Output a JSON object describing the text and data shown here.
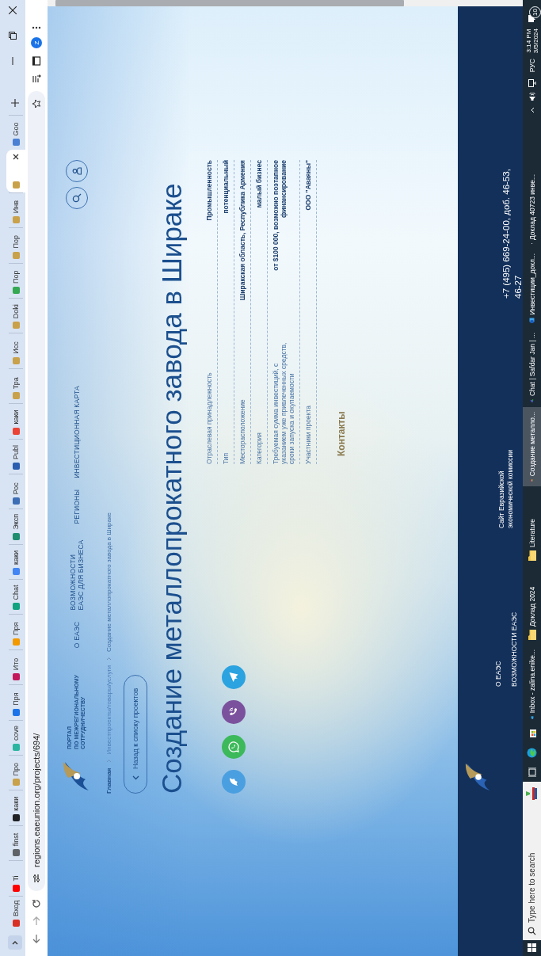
{
  "browser": {
    "tabs": [
      {
        "label": "Вход",
        "color": "#d93025",
        "selected": false
      },
      {
        "label": "Ti",
        "color": "#ff0000",
        "selected": false
      },
      {
        "label": "finst",
        "color": "#5f6368",
        "selected": false
      },
      {
        "label": "каки",
        "color": "#202124",
        "selected": false
      },
      {
        "label": "Про",
        "color": "#c9a14a",
        "selected": false
      },
      {
        "label": "cove",
        "color": "#2bb5a0",
        "selected": false
      },
      {
        "label": "Пря",
        "color": "#1a73e8",
        "selected": false
      },
      {
        "label": "Ито",
        "color": "#c2185b",
        "selected": false
      },
      {
        "label": "Пря",
        "color": "#f29900",
        "selected": false
      },
      {
        "label": "Chat",
        "color": "#10a37f",
        "selected": false
      },
      {
        "label": "каки",
        "color": "#4285f4",
        "selected": false
      },
      {
        "label": "Эксп",
        "color": "#1e8e6e",
        "selected": false
      },
      {
        "label": "Рос",
        "color": "#3c6db5",
        "selected": false
      },
      {
        "label": "Publ",
        "color": "#2a5db0",
        "selected": false
      },
      {
        "label": "каки",
        "color": "#ea4335",
        "selected": false
      },
      {
        "label": "Тра",
        "color": "#c9a14a",
        "selected": false
      },
      {
        "label": "Исс",
        "color": "#c9a14a",
        "selected": false
      },
      {
        "label": "Doki",
        "color": "#c9a14a",
        "selected": false
      },
      {
        "label": "Пор",
        "color": "#34a853",
        "selected": false
      },
      {
        "label": "Пор",
        "color": "#c9a14a",
        "selected": false
      },
      {
        "label": "Инв",
        "color": "#c9a14a",
        "selected": false
      },
      {
        "color": "#c9a14a",
        "selected": true
      },
      {
        "label": "Goo",
        "color": "#4a7fd4",
        "selected": false
      }
    ],
    "url": "regions.eaeunion.org/projects/694/",
    "profile": "Z"
  },
  "header": {
    "portal_lines": [
      "ПОРТАЛ",
      "ПО МЕЖРЕГИОНАЛЬНОМУ",
      "СОТРУДНИЧЕСТВУ"
    ],
    "nav": [
      "О ЕАЭС",
      "ВОЗМОЖНОСТИ ЕАЭС ДЛЯ БИЗНЕСА",
      "РЕГИОНЫ",
      "ИНВЕСТИЦИОННАЯ КАРТА"
    ]
  },
  "breadcrumbs": [
    "Главная",
    "Инвестпроекты/товары/услуги",
    "Создание металлопрокатного завода в Шираке"
  ],
  "back_button": "Назад к списку проектов",
  "title": "Создание металлопрокатного завода в Шираке",
  "share": [
    {
      "kind": "bird",
      "color": "#4a9fe0"
    },
    {
      "kind": "whatsapp",
      "color": "#3cb95a"
    },
    {
      "kind": "viber",
      "color": "#7b519d"
    },
    {
      "kind": "telegram",
      "color": "#2aa3e0"
    }
  ],
  "details": [
    {
      "label": "Отраслевая принадлежность",
      "value": "Промышленность"
    },
    {
      "label": "Тип",
      "value": "потенциальный"
    },
    {
      "label": "Месторасположение",
      "value": "Ширакская область, Республика Армения"
    },
    {
      "label": "Категория",
      "value": "малый бизнес"
    },
    {
      "label": "Требуемая сумма инвестиций, с указанием уже привлеченных средств, сроки запуска и окупаемости",
      "value": "от $100 000, возможно поэтапное финансирование"
    },
    {
      "label": "Участники проекта",
      "value": "ООО \"Аваяны\""
    }
  ],
  "contacts_heading": "Контакты",
  "footer": {
    "links": [
      "О ЕАЭС",
      "ВОЗМОЖНОСТИ ЕАЭС"
    ],
    "commission_link": "Сайт Евразийской экономической комиссии",
    "phone": "+7 (495) 669-24-00, доб. 46-53, 46-27"
  },
  "taskbar": {
    "search_placeholder": "Type here to search",
    "apps": [
      {
        "kind": "taskview",
        "selected": false
      },
      {
        "kind": "edge",
        "selected": false
      },
      {
        "kind": "store",
        "selected": false
      },
      {
        "kind": "outlook",
        "label": "Inbox - zalina.enike...",
        "selected": false
      },
      {
        "kind": "folder",
        "label": "Доклад 2024",
        "selected": false
      },
      {
        "kind": "folder",
        "label": "Literature",
        "selected": false
      },
      {
        "kind": "chrome",
        "label": "Создание металло...",
        "selected": true
      },
      {
        "kind": "teams",
        "label": "Chat | Safdar Jan | ...",
        "selected": false
      },
      {
        "kind": "word",
        "label": "Инвестиции_докл...",
        "selected": false
      },
      {
        "kind": "pdf",
        "label": "Доклад 40723 инве...",
        "selected": false
      }
    ],
    "language": "РУС",
    "time": "3:14 PM",
    "date": "3/5/2024",
    "notifications": "10"
  }
}
